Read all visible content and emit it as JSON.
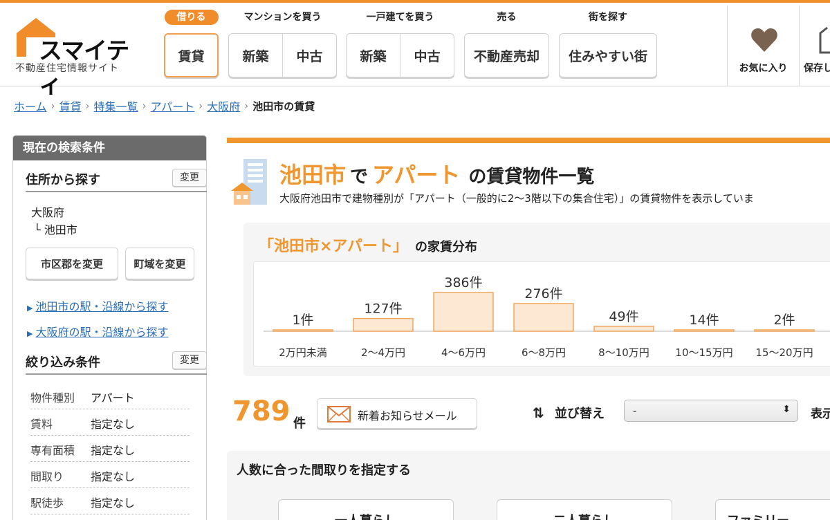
{
  "logo": {
    "name": "スマイティ",
    "subtitle": "不動産住宅情報サイト"
  },
  "nav": [
    {
      "title": "借りる",
      "buttons": [
        "賃貸"
      ]
    },
    {
      "title": "マンションを買う",
      "buttons": [
        "新築",
        "中古"
      ]
    },
    {
      "title": "一戸建てを買う",
      "buttons": [
        "新築",
        "中古"
      ]
    },
    {
      "title": "売る",
      "buttons": [
        "不動産売却"
      ]
    },
    {
      "title": "街を探す",
      "buttons": [
        "住みやすい街"
      ]
    }
  ],
  "utility": {
    "favorites": "お気に入り",
    "saved": "保存し"
  },
  "breadcrumb": {
    "links": [
      "ホーム",
      "賃貸",
      "特集一覧",
      "アパート",
      "大阪府"
    ],
    "current": "池田市の賃貸"
  },
  "sidebar": {
    "header": "現在の検索条件",
    "address_title": "住所から探す",
    "change": "変更",
    "prefecture": "大阪府",
    "city": "└ 池田市",
    "btn_city": "市区郡を変更",
    "btn_town": "町域を変更",
    "link_station_city": "池田市の駅・沿線から探す",
    "link_station_pref": "大阪府の駅・沿線から探す",
    "filter_title": "絞り込み条件",
    "conditions": [
      {
        "key": "物件種別",
        "value": "アパート"
      },
      {
        "key": "賃料",
        "value": "指定なし"
      },
      {
        "key": "専有面積",
        "value": "指定なし"
      },
      {
        "key": "間取り",
        "value": "指定なし"
      },
      {
        "key": "駅徒歩",
        "value": "指定なし"
      }
    ]
  },
  "main": {
    "title_city": "池田市",
    "title_de": "で",
    "title_type": "アパート",
    "title_rest": "の賃貸物件一覧",
    "description": "大阪府池田市で建物種別が「アパート（一般的に2〜3階以下の集合住宅）」の賃貸物件を表示していま",
    "dist_title": "「池田市×アパート」",
    "dist_title_rest": "の家賃分布",
    "count": "789",
    "count_unit": "件",
    "mail_button": "新着お知らせメール",
    "sort_label": "並び替え",
    "sort_value": "-",
    "display_label": "表示",
    "room_title": "人数に合った間取りを指定する",
    "room_cards": [
      "一人暮らし",
      "二人暮らし",
      "ファミリー"
    ]
  },
  "chart_data": {
    "type": "bar",
    "categories": [
      "2万円未満",
      "2〜4万円",
      "4〜6万円",
      "6〜8万円",
      "8〜10万円",
      "10〜15万円",
      "15〜20万円"
    ],
    "values": [
      1,
      127,
      386,
      276,
      49,
      14,
      2
    ],
    "value_labels": [
      "1件",
      "127件",
      "386件",
      "276件",
      "49件",
      "14件",
      "2件"
    ],
    "bar_color": "#fde8d4",
    "bar_border": "#f0a860"
  },
  "colors": {
    "accent": "#f0962e",
    "link": "#2b6fb8"
  }
}
